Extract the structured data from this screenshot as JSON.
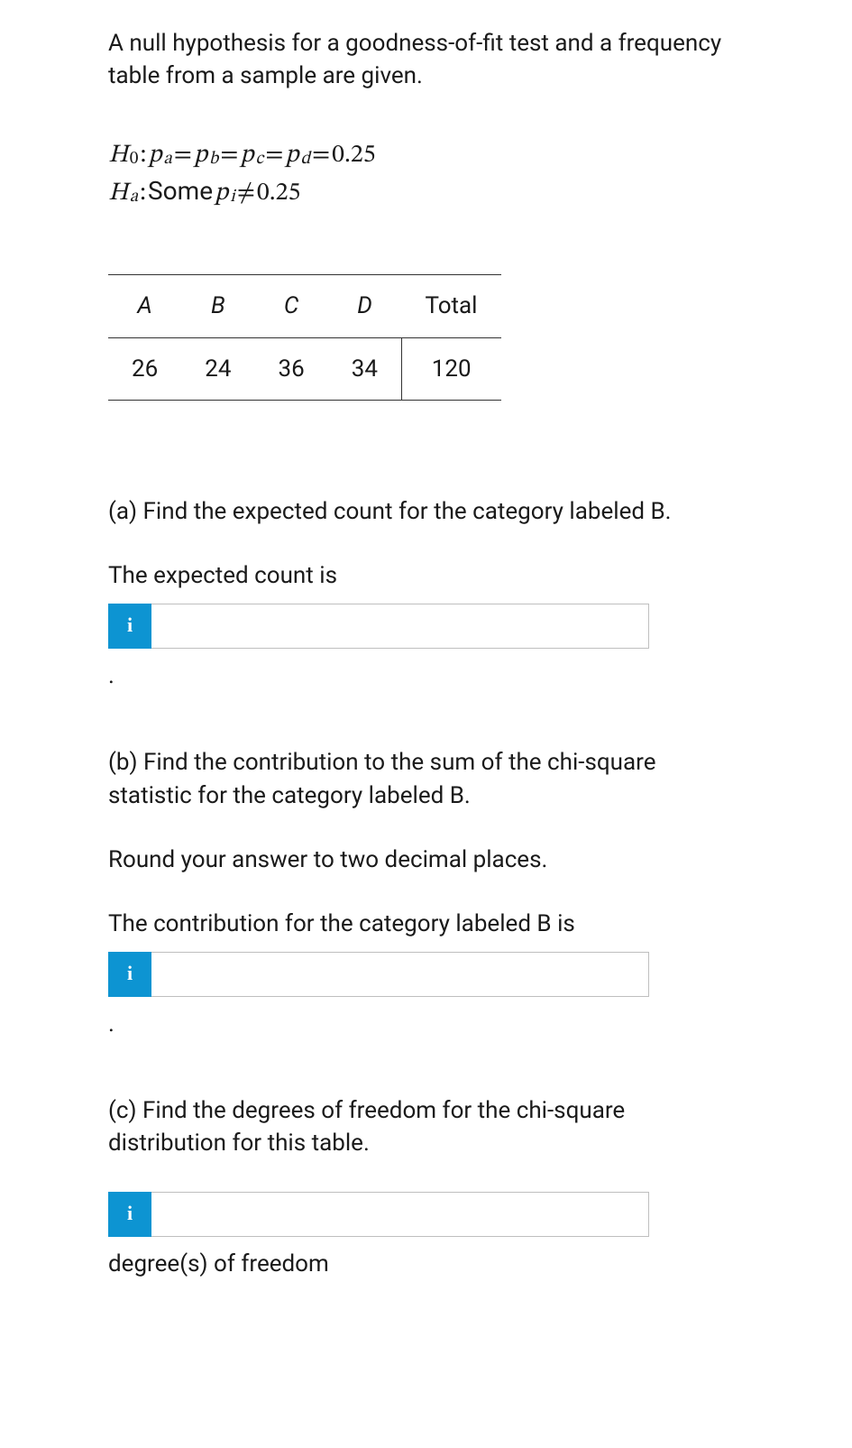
{
  "intro": "A null hypothesis for a goodness-of-fit test and a frequency table from a sample are given.",
  "hypotheses": {
    "h0_label": "H",
    "h0_sub": "0",
    "h0_colon": " : ",
    "p": "p",
    "sub_a": "a",
    "sub_b": "b",
    "sub_c": "c",
    "sub_d": "d",
    "eq": " = ",
    "value": "0.25",
    "ha_label": "H",
    "ha_sub": "a",
    "ha_colon": " : ",
    "ha_text": " Some ",
    "pi_p": "p",
    "pi_sub": "i",
    "neq": " ≠ ",
    "neq_value": "0.25"
  },
  "table": {
    "headers": {
      "a": "A",
      "b": "B",
      "c": "C",
      "d": "D",
      "total": "Total"
    },
    "values": {
      "a": "26",
      "b": "24",
      "c": "36",
      "d": "34",
      "total": "120"
    }
  },
  "partA": {
    "prompt": "(a) Find the expected count for the category labeled B.",
    "label": "The expected count is",
    "period": "."
  },
  "partB": {
    "prompt": "(b) Find the contribution to the sum of the chi-square statistic for the category labeled B.",
    "round": "Round your answer to two decimal places.",
    "label": "The contribution for the category labeled B is",
    "period": "."
  },
  "partC": {
    "prompt": "(c) Find the degrees of freedom for the chi-square distribution for this table.",
    "unit": "degree(s) of freedom"
  },
  "info_glyph": "i"
}
